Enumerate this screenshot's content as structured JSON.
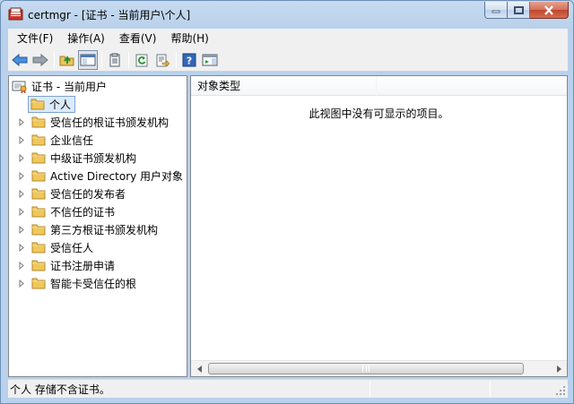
{
  "window": {
    "title": "certmgr - [证书 - 当前用户\\个人]"
  },
  "menu": [
    {
      "label": "文件(F)",
      "name": "menu-file"
    },
    {
      "label": "操作(A)",
      "name": "menu-action"
    },
    {
      "label": "查看(V)",
      "name": "menu-view"
    },
    {
      "label": "帮助(H)",
      "name": "menu-help"
    }
  ],
  "toolbar": {
    "icons": [
      "back-arrow-icon",
      "forward-arrow-icon",
      "up-folder-icon",
      "show-hide-console-tree-icon",
      "properties-icon",
      "refresh-icon",
      "export-list-icon",
      "help-icon",
      "action-pane-icon"
    ]
  },
  "tree": {
    "root": "证书 - 当前用户",
    "items": [
      {
        "label": "个人",
        "selected": true,
        "expandable": false
      },
      {
        "label": "受信任的根证书颁发机构",
        "expandable": true
      },
      {
        "label": "企业信任",
        "expandable": true
      },
      {
        "label": "中级证书颁发机构",
        "expandable": true
      },
      {
        "label": "Active Directory 用户对象",
        "expandable": true
      },
      {
        "label": "受信任的发布者",
        "expandable": true
      },
      {
        "label": "不信任的证书",
        "expandable": true
      },
      {
        "label": "第三方根证书颁发机构",
        "expandable": true
      },
      {
        "label": "受信任人",
        "expandable": true
      },
      {
        "label": "证书注册申请",
        "expandable": true
      },
      {
        "label": "智能卡受信任的根",
        "expandable": true
      }
    ]
  },
  "list": {
    "column_header": "对象类型",
    "empty_message": "此视图中没有可显示的项目。"
  },
  "status": {
    "text": "个人 存储不含证书。"
  },
  "colors": {
    "selection_bg": "#dcebfc",
    "selection_border": "#7da2ce",
    "folder": "#f0c75a"
  }
}
